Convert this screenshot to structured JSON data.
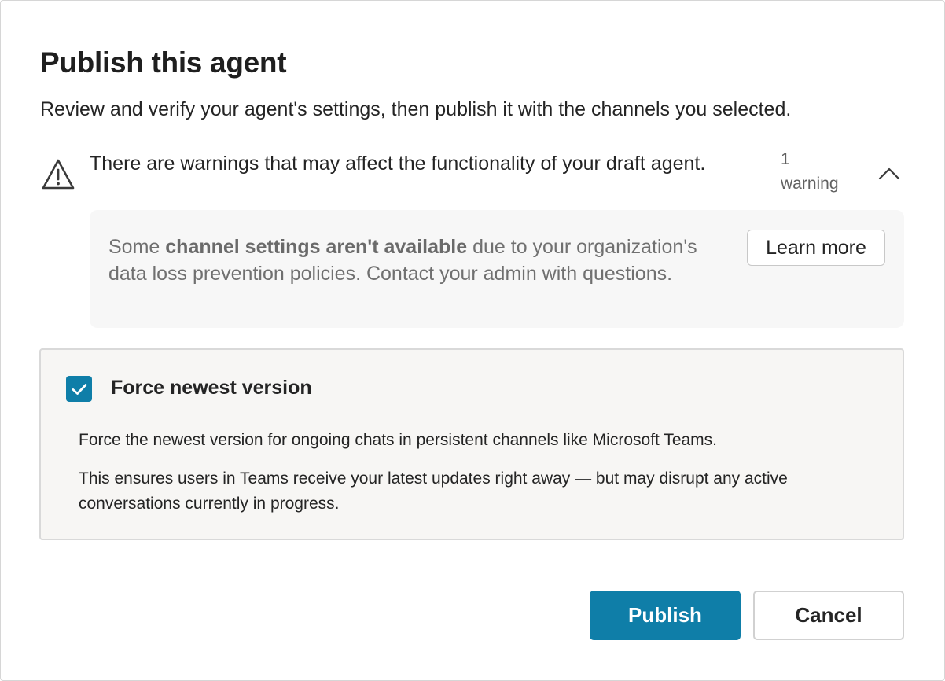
{
  "dialog": {
    "title": "Publish this agent",
    "subtitle": "Review and verify your agent's settings, then publish it with the channels you selected."
  },
  "warning": {
    "icon": "warning-triangle-icon",
    "message": "There are warnings that may affect the functionality of your draft agent.",
    "count_number": "1",
    "count_label": "warning",
    "collapse_icon": "chevron-up-icon",
    "detail": {
      "prefix": "Some ",
      "bold": "channel settings aren't available",
      "suffix": " due to your organization's data loss prevention policies. Contact your admin with questions."
    },
    "learn_more_label": "Learn more"
  },
  "option": {
    "checked": true,
    "checkbox_icon": "checkmark-icon",
    "label": "Force newest version",
    "description_1": "Force the newest version for ongoing chats in persistent channels like Microsoft Teams.",
    "description_2": "This ensures users in Teams receive your latest updates right away — but may disrupt any active conversations currently in progress."
  },
  "actions": {
    "publish_label": "Publish",
    "cancel_label": "Cancel"
  },
  "colors": {
    "accent": "#0f7ea8",
    "panel_background": "#f7f6f4",
    "warning_detail_background": "#f7f7f7"
  }
}
